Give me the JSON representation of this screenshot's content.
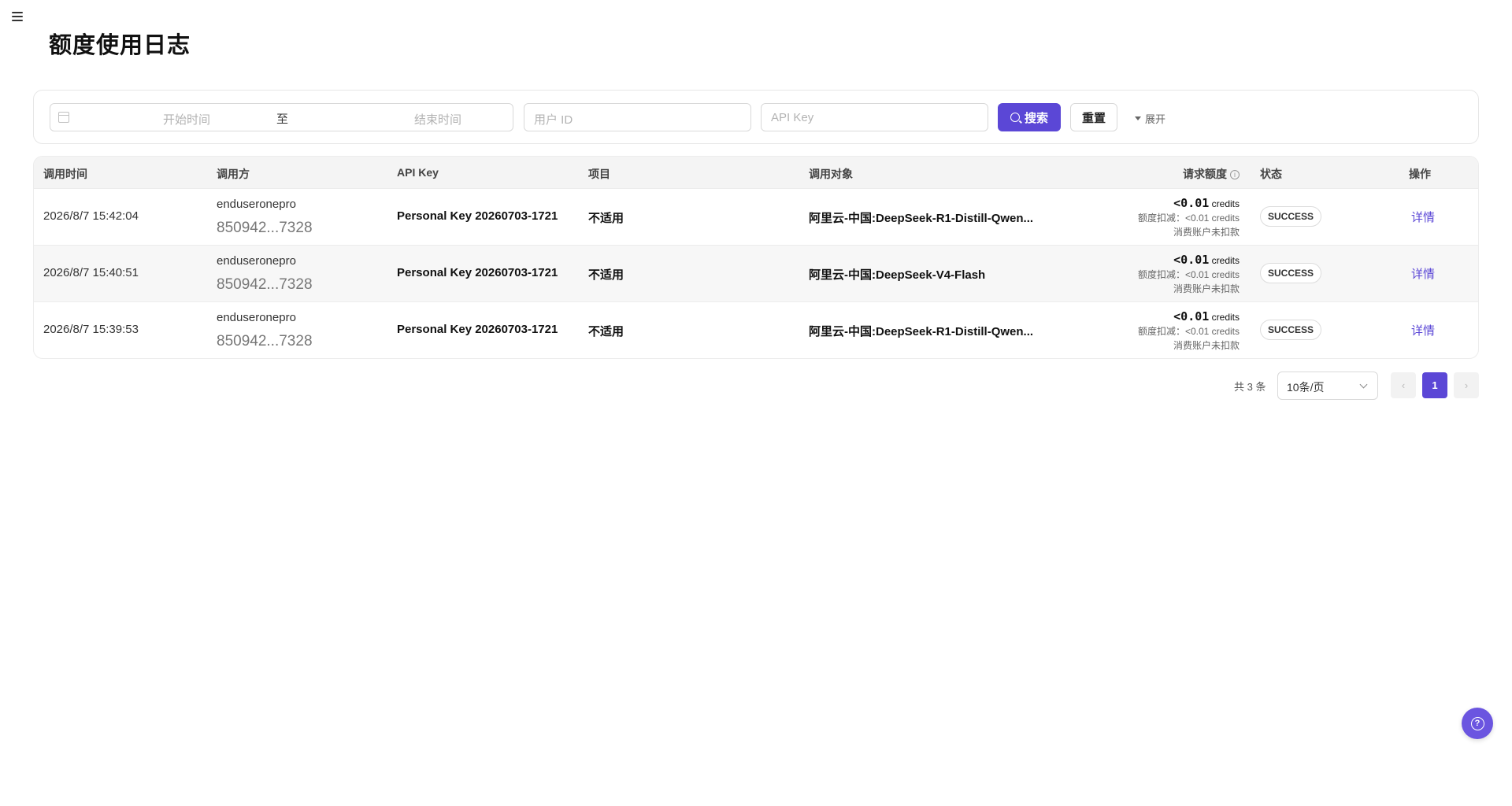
{
  "page": {
    "title": "额度使用日志"
  },
  "colors": {
    "accent": "#5b47d6",
    "help": "#6b55e0"
  },
  "filters": {
    "start_placeholder": "开始时间",
    "separator": "至",
    "end_placeholder": "结束时间",
    "user_id_placeholder": "用户 ID",
    "api_key_placeholder": "API Key",
    "search_label": "搜索",
    "reset_label": "重置",
    "expand_label": "展开"
  },
  "table": {
    "columns": {
      "time": "调用时间",
      "caller": "调用方",
      "api_key": "API Key",
      "project": "项目",
      "target": "调用对象",
      "credits": "请求额度",
      "status": "状态",
      "action": "操作"
    },
    "rows": [
      {
        "time": "2026/8/7 15:42:04",
        "caller_name": "enduseronepro",
        "caller_id": "850942...7328",
        "api_key": "Personal Key 20260703-1721",
        "project": "不适用",
        "target": "阿里云-中国:DeepSeek-R1-Distill-Qwen...",
        "amount": "<0.01",
        "unit": "credits",
        "deduct": "额度扣减：<0.01 credits",
        "note": "消费账户未扣款",
        "status": "SUCCESS",
        "action": "详情"
      },
      {
        "time": "2026/8/7 15:40:51",
        "caller_name": "enduseronepro",
        "caller_id": "850942...7328",
        "api_key": "Personal Key 20260703-1721",
        "project": "不适用",
        "target": "阿里云-中国:DeepSeek-V4-Flash",
        "amount": "<0.01",
        "unit": "credits",
        "deduct": "额度扣减：<0.01 credits",
        "note": "消费账户未扣款",
        "status": "SUCCESS",
        "action": "详情"
      },
      {
        "time": "2026/8/7 15:39:53",
        "caller_name": "enduseronepro",
        "caller_id": "850942...7328",
        "api_key": "Personal Key 20260703-1721",
        "project": "不适用",
        "target": "阿里云-中国:DeepSeek-R1-Distill-Qwen...",
        "amount": "<0.01",
        "unit": "credits",
        "deduct": "额度扣减：<0.01 credits",
        "note": "消费账户未扣款",
        "status": "SUCCESS",
        "action": "详情"
      }
    ]
  },
  "pagination": {
    "total": "共 3 条",
    "page_size": "10条/页",
    "current_page": "1",
    "prev_icon": "chevron-left-icon",
    "next_icon": "chevron-right-icon"
  },
  "icons": {
    "menu": "menu-collapse-icon",
    "calendar": "calendar-icon",
    "search": "search-icon",
    "info": "info-circle-icon",
    "help": "question-circle-icon"
  }
}
